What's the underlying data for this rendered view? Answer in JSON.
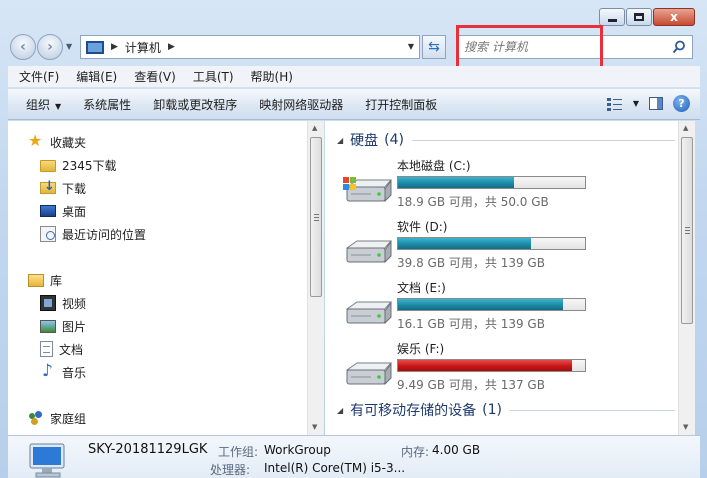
{
  "window": {
    "caption_close": "x"
  },
  "address": {
    "location": "计算机",
    "search_placeholder": "搜索 计算机"
  },
  "menu": [
    "文件(F)",
    "编辑(E)",
    "查看(V)",
    "工具(T)",
    "帮助(H)"
  ],
  "toolbar": {
    "organize": "组织",
    "system_properties": "系统属性",
    "uninstall": "卸载或更改程序",
    "map_drive": "映射网络驱动器",
    "control_panel": "打开控制面板",
    "help": "?"
  },
  "nav": {
    "favorites": "收藏夹",
    "fav_items": [
      "2345下载",
      "下载",
      "桌面",
      "最近访问的位置"
    ],
    "libraries": "库",
    "lib_items": [
      "视频",
      "图片",
      "文档",
      "音乐"
    ],
    "homegroup": "家庭组"
  },
  "main": {
    "hard_disks": {
      "title": "硬盘",
      "count": "(4)"
    },
    "drives": [
      {
        "name": "本地磁盘 (C:)",
        "info": "18.9 GB 可用，共 50.0 GB",
        "used_fraction": 0.62,
        "color": "#1d8aa8",
        "system": true
      },
      {
        "name": "软件 (D:)",
        "info": "39.8 GB 可用，共 139 GB",
        "used_fraction": 0.71,
        "color": "#1d8aa8",
        "system": false
      },
      {
        "name": "文档 (E:)",
        "info": "16.1 GB 可用，共 139 GB",
        "used_fraction": 0.88,
        "color": "#1d8aa8",
        "system": false
      },
      {
        "name": "娱乐 (F:)",
        "info": "9.49 GB 可用，共 137 GB",
        "used_fraction": 0.93,
        "color": "#c81818",
        "system": false
      }
    ],
    "removable": {
      "title": "有可移动存储的设备",
      "count": "(1)"
    }
  },
  "details": {
    "computer_name": "SKY-20181129LGK",
    "workgroup_label": "工作组:",
    "workgroup_value": "WorkGroup",
    "memory_label": "内存:",
    "memory_value": "4.00 GB",
    "cpu_label": "处理器:",
    "cpu_value": "Intel(R) Core(TM) i5-3..."
  }
}
